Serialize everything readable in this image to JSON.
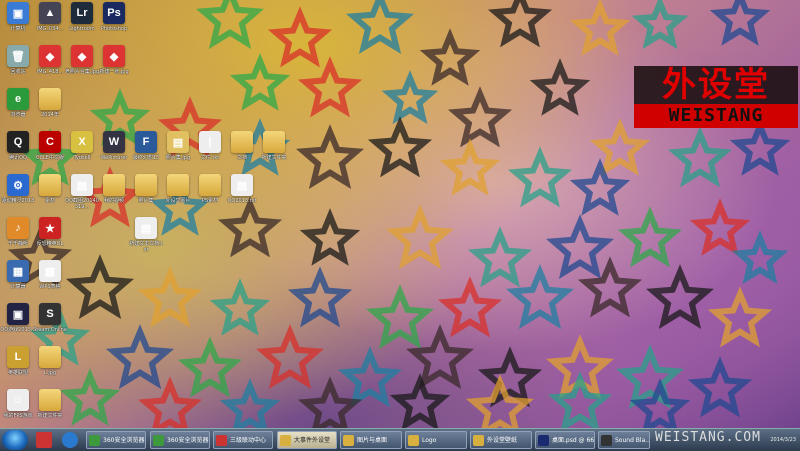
{
  "desktop": {
    "icons": [
      {
        "label": "计算机",
        "glyph": "▣",
        "color": "#3a7bd5"
      },
      {
        "label": "IMG_034...",
        "glyph": "▲",
        "color": "#445"
      },
      {
        "label": "Lightroom",
        "glyph": "Lr",
        "color": "#1d2b3a"
      },
      {
        "label": "Photoshop",
        "glyph": "Ps",
        "color": "#1a2a60"
      },
      {
        "label": "回收站",
        "glyph": "🗑",
        "color": "#8aa"
      },
      {
        "label": "IMG_418...",
        "glyph": "◆",
        "color": "#d33"
      },
      {
        "label": "老照片合集.jpg",
        "glyph": "◆",
        "color": "#d33"
      },
      {
        "label": "新建一张.jpg",
        "glyph": "◆",
        "color": "#d33"
      },
      {
        "label": "浏览器",
        "glyph": "e",
        "color": "#2a9a3a"
      },
      {
        "label": "2014年",
        "glyph": "",
        "color": "#e0b040"
      },
      {
        "label": "腾讯QQ",
        "glyph": "Q",
        "color": "#222"
      },
      {
        "label": "CCLE中文版",
        "glyph": "C",
        "color": "#b00"
      },
      {
        "label": "Tydsell",
        "glyph": "X",
        "color": "#d8c040"
      },
      {
        "label": "WePicturer",
        "glyph": "W",
        "color": "#334"
      },
      {
        "label": "最终幻想15",
        "glyph": "F",
        "color": "#2a5a9a"
      },
      {
        "label": "照片集.jpg",
        "glyph": "▤",
        "color": "#e0c060"
      },
      {
        "label": "文件.txt",
        "glyph": "|",
        "color": "#eee"
      },
      {
        "label": "文档",
        "glyph": "",
        "color": "#e0b040"
      },
      {
        "label": "新建文件夹",
        "glyph": "",
        "color": "#e0b040"
      },
      {
        "label": "驱动精灵2013",
        "glyph": "⚙",
        "color": "#2a6ad0"
      },
      {
        "label": "素材",
        "glyph": "",
        "color": "#e0b040"
      },
      {
        "label": "QQ截图20140319...",
        "glyph": "▤",
        "color": "#eee"
      },
      {
        "label": "我的视频",
        "glyph": "",
        "color": "#e0b040"
      },
      {
        "label": "照片集",
        "glyph": "",
        "color": "#e0b040"
      },
      {
        "label": "外设堂图片",
        "glyph": "",
        "color": "#e0b040"
      },
      {
        "label": "PS素材",
        "glyph": "",
        "color": "#e0b040"
      },
      {
        "label": "QQ2013.txt",
        "glyph": "▤",
        "color": "#eee"
      },
      {
        "label": "千千静听",
        "glyph": "♪",
        "color": "#e08a2a"
      },
      {
        "label": "反恐精英OL",
        "glyph": "★",
        "color": "#c22"
      },
      {
        "label": "新建文本文档.txt",
        "glyph": "▤",
        "color": "#eee"
      },
      {
        "label": "计算器",
        "glyph": "▦",
        "color": "#3a6ab0"
      },
      {
        "label": "WPS表格",
        "glyph": "▦",
        "color": "#eee"
      },
      {
        "label": "QQ游戏2013...",
        "glyph": "▣",
        "color": "#224"
      },
      {
        "label": "Steam Online",
        "glyph": "S",
        "color": "#333"
      },
      {
        "label": "英雄联盟",
        "glyph": "L",
        "color": "#caa030"
      },
      {
        "label": "L.jpg",
        "glyph": "",
        "color": "#e0b040"
      },
      {
        "label": "我的FPS游戏",
        "glyph": "☺",
        "color": "#eee"
      },
      {
        "label": "新建文件夹",
        "glyph": "",
        "color": "#e0b040"
      }
    ]
  },
  "logo": {
    "main": "外设堂",
    "sub": "WEISTANG"
  },
  "taskbar": {
    "items": [
      {
        "label": "360安全浏览器",
        "color": "#3c9a3c"
      },
      {
        "label": "360安全浏览器",
        "color": "#3c9a3c"
      },
      {
        "label": "三级联动中心",
        "color": "#c33"
      },
      {
        "label": "大事件外设堂",
        "color": "#d8b040",
        "active": true
      },
      {
        "label": "图片与桌面",
        "color": "#d8b040"
      },
      {
        "label": "Logo",
        "color": "#d8b040"
      },
      {
        "label": "外设堂壁纸",
        "color": "#d8b040"
      },
      {
        "label": "桌面.psd @ 66...",
        "color": "#1a2a70"
      },
      {
        "label": "Sound Bla...",
        "color": "#333"
      }
    ],
    "watermark": "WEISTANG.COM",
    "clock_date": "2014/3/23"
  }
}
